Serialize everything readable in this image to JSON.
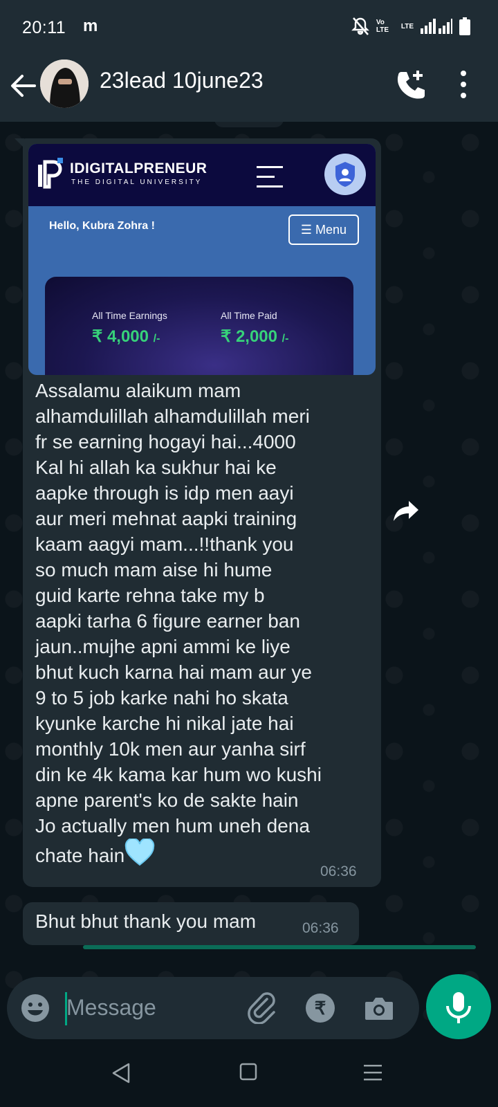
{
  "status_bar": {
    "time": "20:11",
    "carrier_icon": "m",
    "volte": "Vo LTE",
    "lte": "LTE"
  },
  "header": {
    "contact_name": "23lead 10june23",
    "icons": [
      "back-arrow-icon",
      "add-call-icon",
      "more-vert-icon"
    ]
  },
  "colors": {
    "header_bg": "#1f2c34",
    "chat_bg": "#0b141a",
    "bubble_bg": "#202c33",
    "accent": "#00a884",
    "earnings_green": "#37d27a"
  },
  "messages": [
    {
      "image": {
        "brand_name": "IDIGITALPRENEUR",
        "brand_tagline": "THE DIGITAL UNIVERSITY",
        "greeting": "Hello, Kubra Zohra !",
        "menu_label": "☰ Menu",
        "earnings_label": "All Time Earnings",
        "earnings_value": "₹ 4,000",
        "earnings_suffix": "/-",
        "paid_label": "All Time Paid",
        "paid_value": "₹ 2,000",
        "paid_suffix": "/-"
      },
      "text": "Assalamu alaikum mam\nalhamdulillah alhamdulillah meri\nfr se earning hogayi hai...4000\nKal hi allah ka sukhur hai ke\naapke through is idp men aayi\naur meri mehnat aapki training\nkaam aagyi mam...!!thank you\nso much mam aise hi hume\nguid karte rehna take my b\naapki tarha 6 figure earner ban\njaun..mujhe apni ammi ke liye\nbhut kuch karna hai mam aur ye\n9 to 5 job karke nahi ho skata\nkyunke karche hi nikal jate hai\nmonthly 10k men aur yanha sirf\ndin ke 4k kama kar hum wo kushi\napne parent's ko de sakte hain\nJo actually men hum uneh dena\nchate hain",
      "emoji": "light-blue-heart",
      "time": "06:36"
    },
    {
      "text": "Bhut bhut thank you mam",
      "time": "06:36"
    }
  ],
  "input": {
    "placeholder": "Message",
    "rupee_symbol": "₹"
  }
}
